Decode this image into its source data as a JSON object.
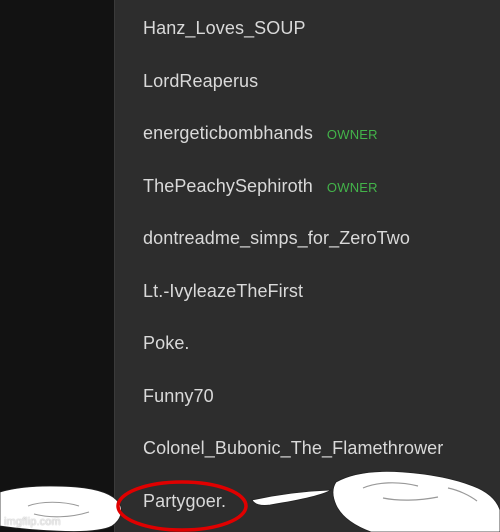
{
  "members": [
    {
      "name": "Hanz_Loves_SOUP",
      "role": ""
    },
    {
      "name": "LordReaperus",
      "role": ""
    },
    {
      "name": "energeticbombhands",
      "role": "OWNER"
    },
    {
      "name": "ThePeachySephiroth",
      "role": "OWNER"
    },
    {
      "name": "dontreadme_simps_for_ZeroTwo",
      "role": ""
    },
    {
      "name": "Lt.-IvyleazeTheFirst",
      "role": ""
    },
    {
      "name": "Poke.",
      "role": ""
    },
    {
      "name": "Funny70",
      "role": ""
    },
    {
      "name": "Colonel_Bubonic_The_Flamethrower",
      "role": ""
    },
    {
      "name": "Partygoer.",
      "role": ""
    }
  ],
  "watermark": "imgflip.com",
  "colors": {
    "panel_bg": "#2d2d2d",
    "left_bg": "#121212",
    "name_text": "#d9d9d9",
    "owner_badge": "#43b34a",
    "highlight_circle": "#e00000",
    "sketch_fill": "#ffffff"
  }
}
